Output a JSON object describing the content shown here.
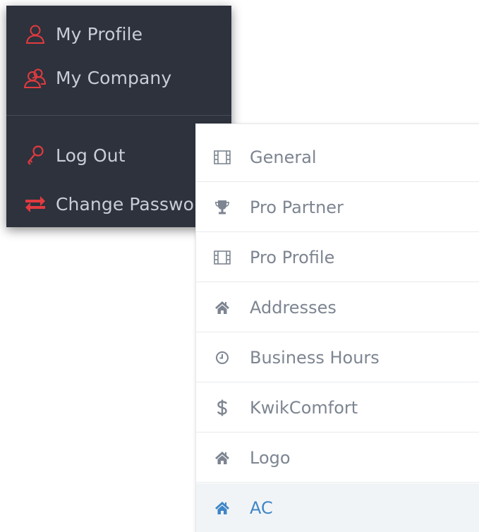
{
  "user_menu": {
    "items": [
      {
        "label": "My Profile",
        "icon": "user-icon"
      },
      {
        "label": "My Company",
        "icon": "users-icon"
      },
      {
        "label": "Log Out",
        "icon": "key-icon"
      },
      {
        "label": "Change Password",
        "icon": "exchange-icon"
      }
    ],
    "icon_color": "#e23b3f",
    "background": "#2d323d"
  },
  "settings_nav": {
    "items": [
      {
        "label": "General",
        "icon": "film-icon"
      },
      {
        "label": "Pro Partner",
        "icon": "trophy-icon"
      },
      {
        "label": "Pro Profile",
        "icon": "film-icon"
      },
      {
        "label": "Addresses",
        "icon": "home-icon"
      },
      {
        "label": "Business Hours",
        "icon": "clock-icon"
      },
      {
        "label": "KwikComfort",
        "icon": "dollar-icon"
      },
      {
        "label": "Logo",
        "icon": "home-icon"
      },
      {
        "label": "AC",
        "icon": "home-icon",
        "active": true
      }
    ],
    "active_color": "#3f86c6"
  }
}
